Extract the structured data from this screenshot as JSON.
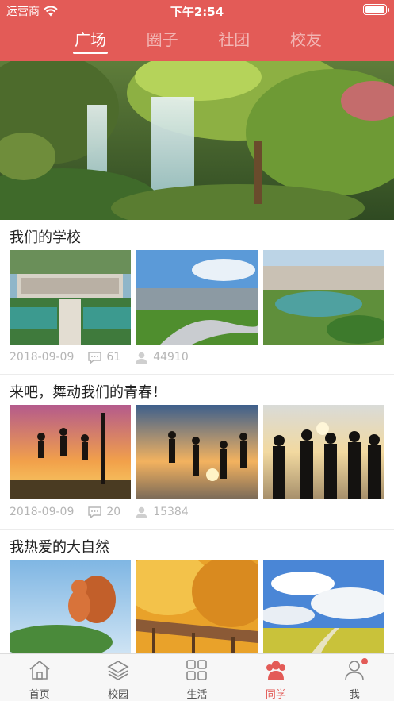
{
  "status_bar": {
    "carrier": "运营商",
    "time": "下午2:54"
  },
  "tabs": [
    {
      "label": "广场",
      "active": true
    },
    {
      "label": "圈子",
      "active": false
    },
    {
      "label": "社团",
      "active": false
    },
    {
      "label": "校友",
      "active": false
    }
  ],
  "posts": [
    {
      "title": "我们的学校",
      "date": "2018-09-09",
      "comments": "61",
      "views": "44910"
    },
    {
      "title": "来吧，舞动我们的青春！",
      "date": "2018-09-09",
      "comments": "20",
      "views": "15384"
    },
    {
      "title": "我热爱的大自然",
      "date": "",
      "comments": "",
      "views": ""
    }
  ],
  "bottom_nav": [
    {
      "label": "首页",
      "icon": "home-icon",
      "active": false
    },
    {
      "label": "校园",
      "icon": "layers-icon",
      "active": false
    },
    {
      "label": "生活",
      "icon": "grid-icon",
      "active": false
    },
    {
      "label": "同学",
      "icon": "classmates-icon",
      "active": true
    },
    {
      "label": "我",
      "icon": "user-icon",
      "active": false,
      "badge": true
    }
  ],
  "colors": {
    "accent": "#e35b57",
    "muted": "#b5b5b5"
  }
}
